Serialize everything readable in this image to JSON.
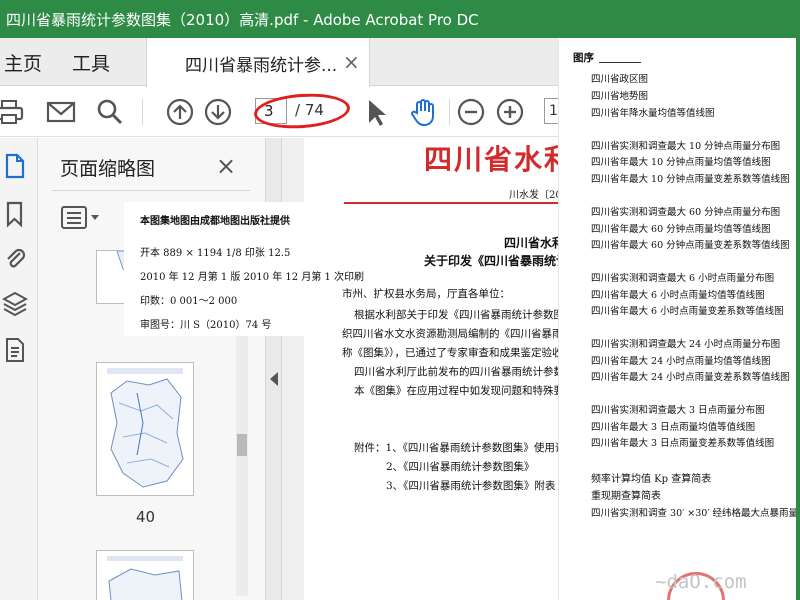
{
  "window": {
    "title": "四川省暴雨统计参数图集（2010）高清.pdf - Adobe Acrobat Pro DC"
  },
  "tabs": {
    "home": "主页",
    "tools": "工具",
    "document": "四川省暴雨统计参...",
    "close": "×"
  },
  "toolbar": {
    "page_current": "3",
    "page_total": "/ 74",
    "zoom_fragment": "1",
    "icons": [
      "print-icon",
      "mail-icon",
      "search-icon",
      "page-up-icon",
      "page-down-icon",
      "select-cursor-icon",
      "hand-icon",
      "zoom-out-icon",
      "zoom-in-icon"
    ]
  },
  "annotation": {
    "color": "#e01e1e"
  },
  "thumbnail_panel": {
    "title": "页面缩略图",
    "close": "×",
    "page_number": "40"
  },
  "document": {
    "header": "四川省水利",
    "ref": "川水发〔201",
    "lines": [
      "四川省水利",
      "关于印发《四川省暴雨统计",
      "市州、扩权县水务局，厅直各单位：",
      "根据水利部关于印发《四川省暴雨统计参数图集》",
      "织四川省水文水资源勘测局编制的《四川省暴雨统计",
      "称《图集》），已通过了专家审查和成果鉴定验收，现",
      "四川省水利厅此前发布的四川省暴雨统计参数等",
      "本《图集》在应用过程中如发现问题和特殊要求，",
      "附件：1、《四川省暴雨统计参数图集》使用说明",
      "2、《四川省暴雨统计参数图集》",
      "3、《四川省暴雨统计参数图集》附表"
    ]
  },
  "popup": {
    "lines": [
      "本图集地图由成都地图出版社提供",
      "开本 889 × 1194    1/8    印张 12.5",
      "2010 年 12 月第 1 版    2010 年 12 月第 1 次印刷",
      "印数：0 001～2 000",
      "审图号：川 S（2010）74 号"
    ]
  },
  "toc": {
    "heading": "图序",
    "items": [
      "四川省政区图",
      "四川省地势图",
      "四川省年降水量均值等值线图",
      "四川省实测和调查最大 10 分钟点雨量分布图",
      "四川省年最大 10 分钟点雨量均值等值线图",
      "四川省年最大 10 分钟点雨量变差系数等值线图",
      "四川省实测和调查最大 60 分钟点雨量分布图",
      "四川省年最大 60 分钟点雨量均值等值线图",
      "四川省年最大 60 分钟点雨量变差系数等值线图",
      "四川省实测和调查最大 6 小时点雨量分布图",
      "四川省年最大 6 小时点雨量均值等值线图",
      "四川省年最大 6 小时点雨量变差系数等值线图",
      "四川省实测和调查最大 24 小时点雨量分布图",
      "四川省年最大 24 小时点雨量均值等值线图",
      "四川省年最大 24 小时点雨量变差系数等值线图",
      "四川省实测和调查最大 3 日点雨量分布图",
      "四川省年最大 3 日点雨量均值等值线图",
      "四川省年最大 3 日点雨量变差系数等值线图",
      "频率计算均值 Kp 查算简表",
      "重现期查算简表",
      "四川省实测和调查 30′ ×30′ 经纬格最大点暴雨量"
    ]
  },
  "watermark": {
    "text": "~daO.com"
  },
  "colors": {
    "titlebar": "#2e8b46",
    "doc_red": "#d32b2b"
  }
}
